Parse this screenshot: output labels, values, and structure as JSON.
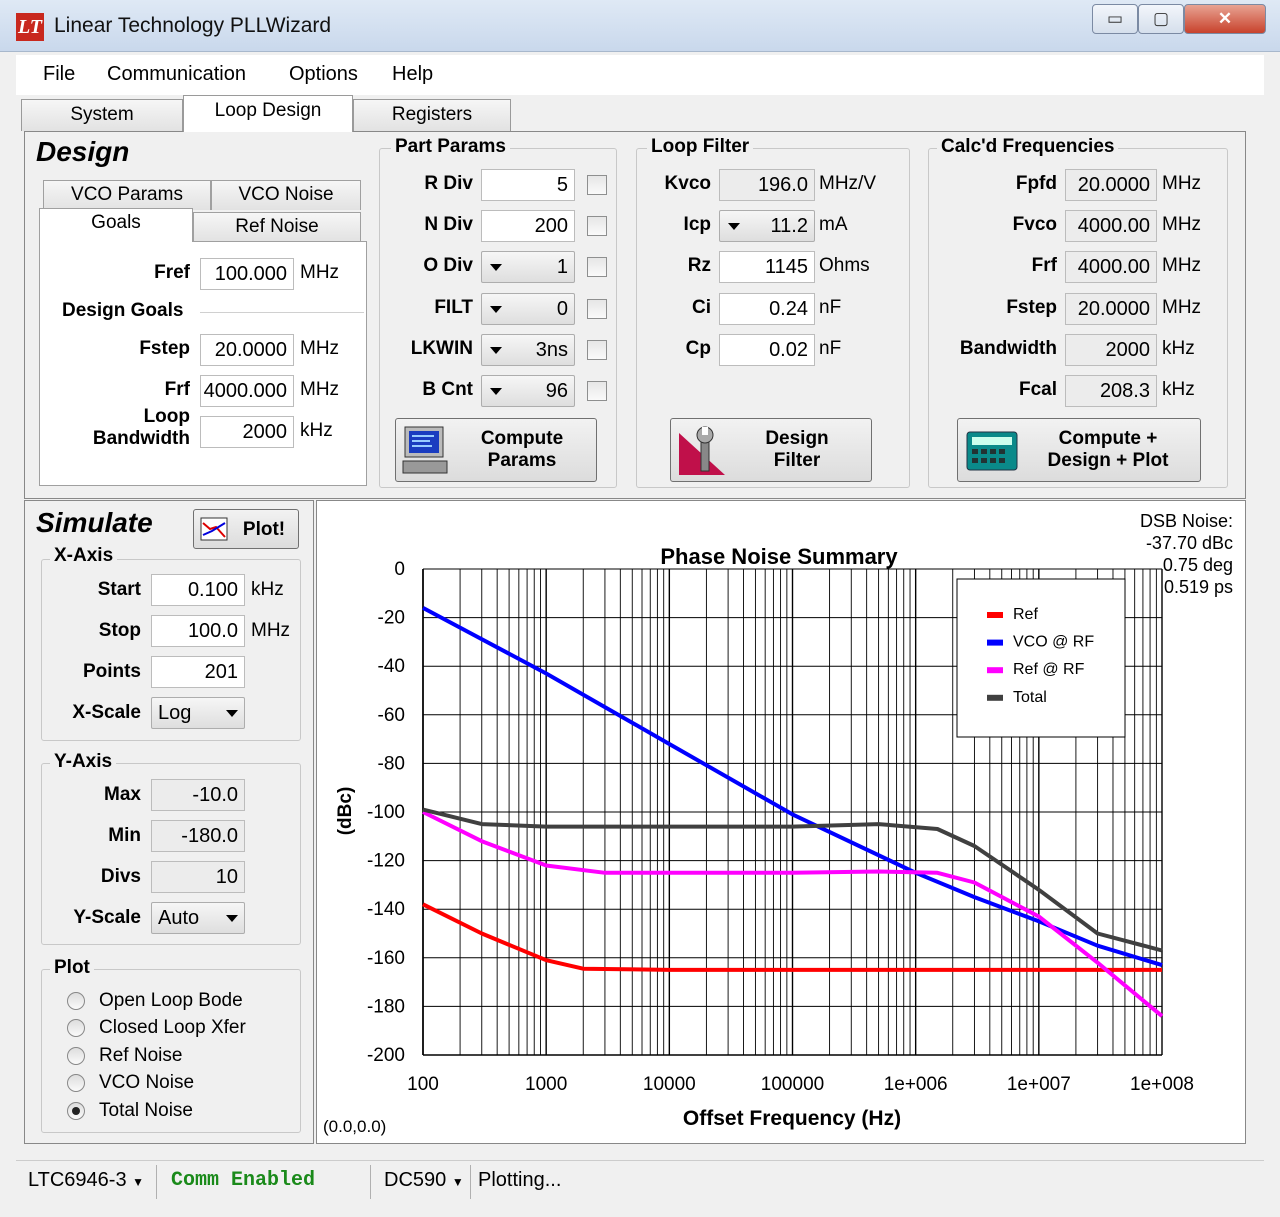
{
  "window": {
    "title": "Linear Technology PLLWizard",
    "logo": "LT",
    "controls": [
      "▭",
      "▢",
      "✕"
    ]
  },
  "menu": [
    "File",
    "Communication",
    "Options",
    "Help"
  ],
  "tabs": [
    "System",
    "Loop Design",
    "Registers"
  ],
  "design": {
    "heading": "Design",
    "subtabs": [
      "VCO Params",
      "VCO Noise",
      "Goals",
      "Ref Noise"
    ],
    "fref": {
      "label": "Fref",
      "value": "100.000",
      "unit": "MHz"
    },
    "goals_title": "Design Goals",
    "fstep": {
      "label": "Fstep",
      "value": "20.0000",
      "unit": "MHz"
    },
    "frf": {
      "label": "Frf",
      "value": "4000.000",
      "unit": "MHz"
    },
    "loop_bw": {
      "label1": "Loop",
      "label2": "Bandwidth",
      "value": "2000",
      "unit": "kHz"
    }
  },
  "part_params": {
    "title": "Part Params",
    "rows": [
      {
        "label": "R Div",
        "value": "5"
      },
      {
        "label": "N Div",
        "value": "200"
      },
      {
        "label": "O Div",
        "value": "1"
      },
      {
        "label": "FILT",
        "value": "0"
      },
      {
        "label": "LKWIN",
        "value": "3ns"
      },
      {
        "label": "B Cnt",
        "value": "96"
      }
    ],
    "button": [
      "Compute",
      "Params"
    ]
  },
  "loop_filter": {
    "title": "Loop Filter",
    "rows": [
      {
        "label": "Kvco",
        "value": "196.0",
        "unit": "MHz/V"
      },
      {
        "label": "Icp",
        "value": "11.2",
        "unit": "mA"
      },
      {
        "label": "Rz",
        "value": "1145",
        "unit": "Ohms"
      },
      {
        "label": "Ci",
        "value": "0.24",
        "unit": "nF"
      },
      {
        "label": "Cp",
        "value": "0.02",
        "unit": "nF"
      }
    ],
    "button": [
      "Design",
      "Filter"
    ]
  },
  "calc_freq": {
    "title": "Calc'd Frequencies",
    "rows": [
      {
        "label": "Fpfd",
        "value": "20.0000",
        "unit": "MHz"
      },
      {
        "label": "Fvco",
        "value": "4000.00",
        "unit": "MHz"
      },
      {
        "label": "Frf",
        "value": "4000.00",
        "unit": "MHz"
      },
      {
        "label": "Fstep",
        "value": "20.0000",
        "unit": "MHz"
      },
      {
        "label": "Bandwidth",
        "value": "2000",
        "unit": "kHz"
      },
      {
        "label": "Fcal",
        "value": "208.3",
        "unit": "kHz"
      }
    ],
    "button": [
      "Compute +",
      "Design + Plot"
    ]
  },
  "simulate": {
    "heading": "Simulate",
    "plot_button": "Plot!",
    "xaxis_title": "X-Axis",
    "start": {
      "label": "Start",
      "value": "0.100",
      "unit": "kHz"
    },
    "stop": {
      "label": "Stop",
      "value": "100.0",
      "unit": "MHz"
    },
    "points": {
      "label": "Points",
      "value": "201"
    },
    "xscale": {
      "label": "X-Scale",
      "value": "Log"
    },
    "yaxis_title": "Y-Axis",
    "max": {
      "label": "Max",
      "value": "-10.0"
    },
    "min": {
      "label": "Min",
      "value": "-180.0"
    },
    "divs": {
      "label": "Divs",
      "value": "10"
    },
    "yscale": {
      "label": "Y-Scale",
      "value": "Auto"
    },
    "plot_title": "Plot",
    "plot_options": [
      "Open Loop Bode",
      "Closed Loop Xfer",
      "Ref Noise",
      "VCO Noise",
      "Total Noise"
    ],
    "selected_option": 4
  },
  "dsb": {
    "line1": "DSB Noise:",
    "line2": "-37.70 dBc",
    "line3": "0.75 deg",
    "line4": "0.519 ps"
  },
  "cursor_readout": "(0.0,0.0)",
  "chart_data": {
    "type": "line",
    "title": "Phase Noise Summary",
    "xlabel": "Offset Frequency (Hz)",
    "ylabel": "(dBc)",
    "xscale": "log",
    "xlim": [
      100,
      100000000
    ],
    "ylim": [
      -200,
      0
    ],
    "xticks": [
      "100",
      "1000",
      "10000",
      "100000",
      "1e+006",
      "1e+007",
      "1e+008"
    ],
    "yticks": [
      "0",
      "-20",
      "-40",
      "-60",
      "-80",
      "-100",
      "-120",
      "-140",
      "-160",
      "-180",
      "-200"
    ],
    "grid": true,
    "legend_position": "top-right",
    "series": [
      {
        "name": "Ref",
        "color": "#ff0000",
        "x": [
          100,
          300,
          1000,
          2000,
          10000,
          100000,
          1000000,
          10000000,
          100000000
        ],
        "y": [
          -138,
          -150,
          -161,
          -164.5,
          -165,
          -165,
          -165,
          -165,
          -165
        ]
      },
      {
        "name": "VCO @ RF",
        "color": "#0000ff",
        "x": [
          100,
          1000,
          10000,
          100000,
          1000000,
          3000000,
          10000000,
          30000000,
          100000000
        ],
        "y": [
          -16,
          -43,
          -72,
          -101,
          -125,
          -135,
          -145,
          -155,
          -163
        ]
      },
      {
        "name": "Ref @ RF",
        "color": "#ff00ff",
        "x": [
          100,
          300,
          1000,
          3000,
          10000,
          100000,
          500000,
          1500000,
          3000000,
          10000000,
          30000000,
          100000000
        ],
        "y": [
          -100,
          -112,
          -122,
          -125,
          -125,
          -125,
          -124.5,
          -125,
          -129,
          -143,
          -162,
          -184
        ]
      },
      {
        "name": "Total",
        "color": "#404040",
        "x": [
          100,
          300,
          1000,
          10000,
          100000,
          500000,
          1500000,
          3000000,
          10000000,
          30000000,
          100000000
        ],
        "y": [
          -99,
          -105,
          -106,
          -106,
          -106,
          -105,
          -107,
          -114,
          -132,
          -150,
          -157
        ]
      }
    ]
  },
  "status": {
    "chip": "LTC6946-3",
    "comm": "Comm Enabled",
    "board": "DC590",
    "msg": "Plotting..."
  },
  "colors": {
    "comm_text": "#1a8a1a",
    "titlebar": "#c9d8ec",
    "close_button": "#c8422c",
    "logo": "#c8281e"
  }
}
